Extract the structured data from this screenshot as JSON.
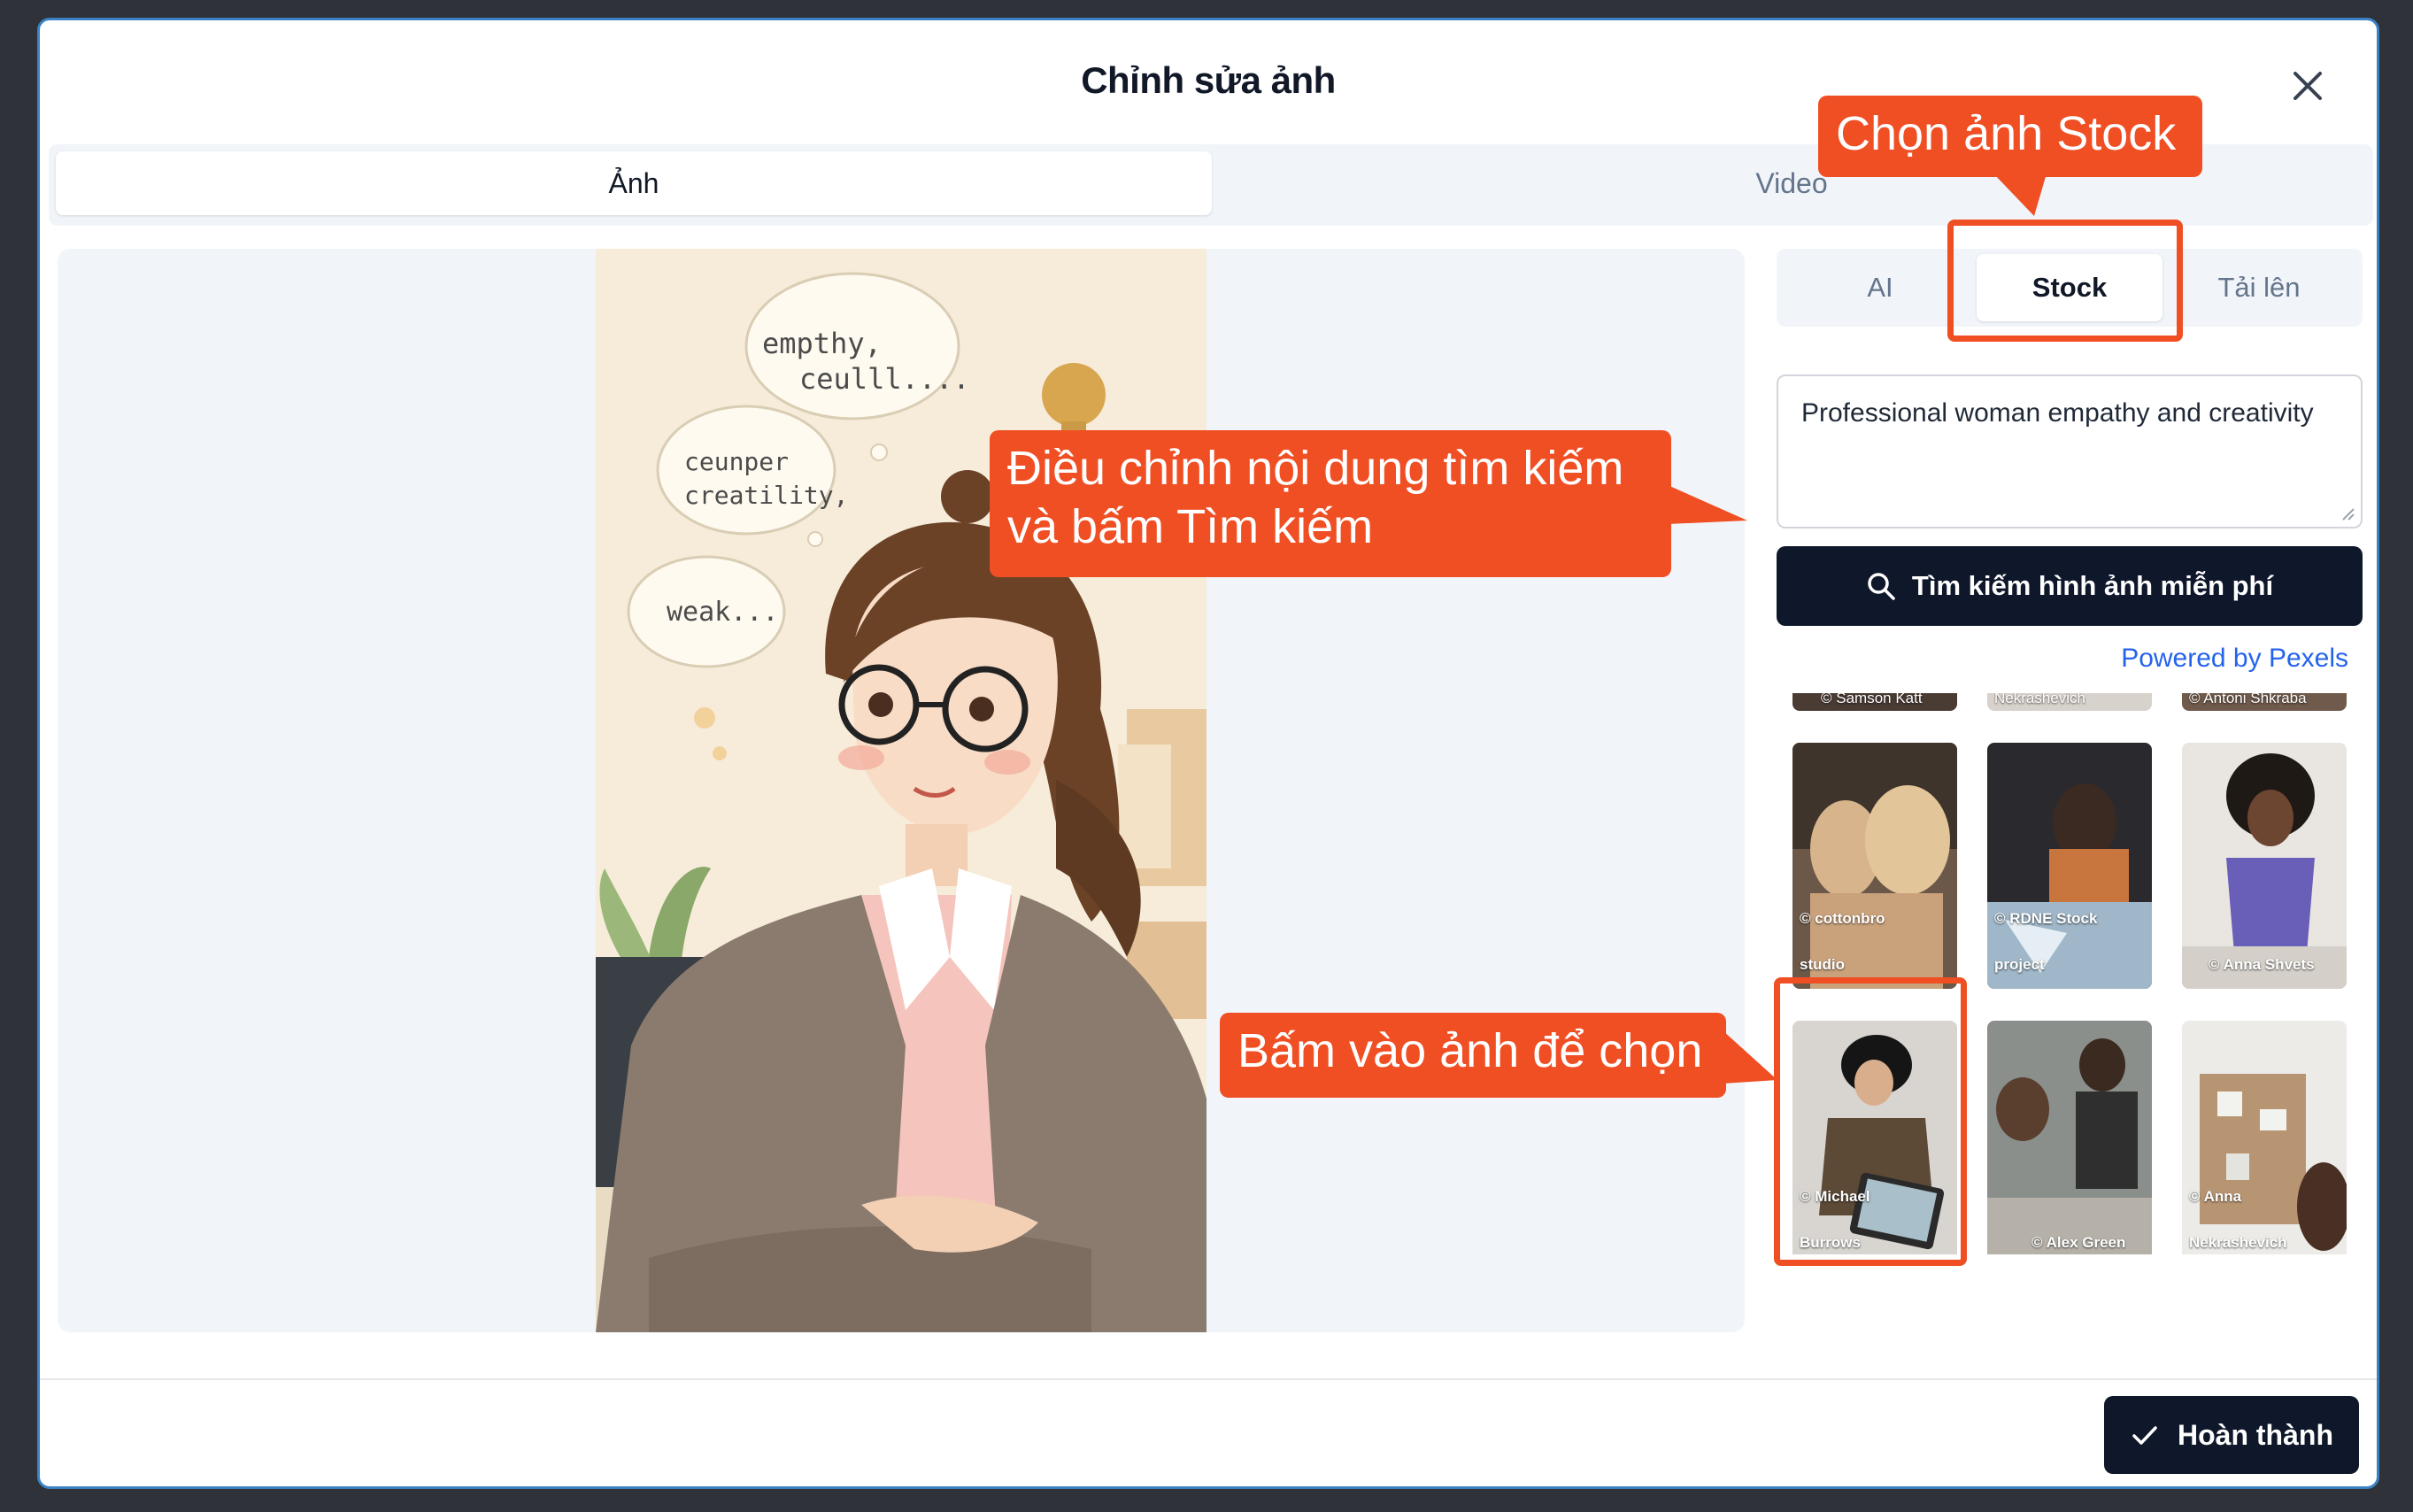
{
  "modal": {
    "title": "Chỉnh sửa ảnh",
    "tabs": [
      {
        "label": "Ảnh",
        "active": true
      },
      {
        "label": "Video",
        "active": false
      }
    ]
  },
  "side": {
    "sub_tabs": [
      {
        "label": "AI"
      },
      {
        "label": "Stock"
      },
      {
        "label": "Tải lên"
      }
    ],
    "search_text": "Professional woman empathy and creativity",
    "search_button": "Tìm kiếm hình ảnh miễn phí",
    "powered_by": "Powered by Pexels",
    "top_row_credits": [
      "© Samson Katt",
      "Nekrashevich",
      "© Antoni Shkraba"
    ],
    "thumbs": [
      {
        "credit_1": "© cottonbro",
        "credit_2": "studio"
      },
      {
        "credit_1": "© RDNE Stock",
        "credit_2": "project"
      },
      {
        "credit_1": "",
        "credit_2": "© Anna Shvets"
      },
      {
        "credit_1": "© Michael",
        "credit_2": "Burrows"
      },
      {
        "credit_1": "",
        "credit_2": "© Alex Green"
      },
      {
        "credit_1": "© Anna",
        "credit_2": "Nekrashevich"
      }
    ]
  },
  "preview": {
    "bubbles": [
      "empthy,",
      "ceulll....",
      "ceunper",
      "creatility,",
      "weak..."
    ]
  },
  "footer": {
    "done_label": "Hoàn thành"
  },
  "annotations": {
    "stock": "Chọn ảnh Stock",
    "search_1": "Điều chỉnh nội dung tìm kiếm",
    "search_2": "và bấm Tìm kiếm",
    "pick": "Bấm vào ảnh để chọn"
  },
  "colors": {
    "accent": "#f04e23",
    "primary": "#0f172a",
    "link": "#2563eb"
  }
}
